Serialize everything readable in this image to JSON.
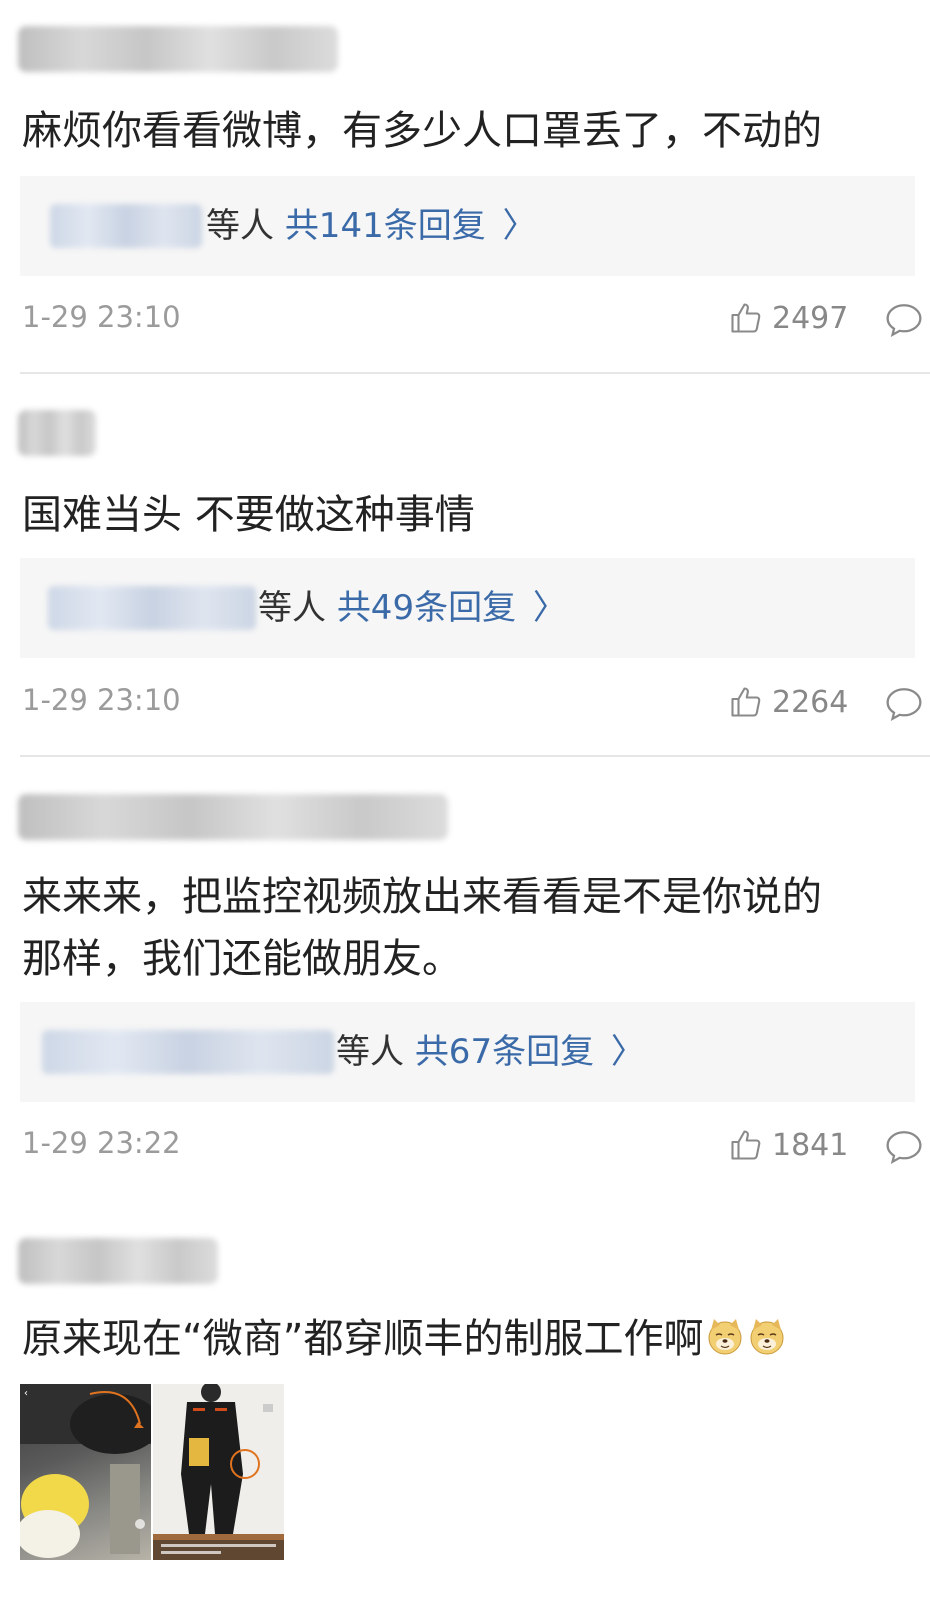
{
  "comments": [
    {
      "text": "麻烦你看看微博，有多少人口罩丢了，不动的",
      "reply_etc": "等人",
      "reply_count": "共141条回复",
      "time": "1-29 23:10",
      "likes": "2497"
    },
    {
      "text": "国难当头 不要做这种事情",
      "reply_etc": "等人",
      "reply_count": "共49条回复",
      "time": "1-29 23:10",
      "likes": "2264"
    },
    {
      "text_line1": "来来来，把监控视频放出来看看是不是你说的",
      "text_line2": "那样，我们还能做朋友。",
      "reply_etc": "等人",
      "reply_count": "共67条回复",
      "time": "1-29 23:22",
      "likes": "1841"
    },
    {
      "text": "原来现在“微商”都穿顺丰的制服工作啊",
      "emoji": "doge-emoji"
    }
  ],
  "icons": {
    "like": "thumbs-up-icon",
    "comment": "comment-bubble-icon",
    "chevron": "chevron-right-icon"
  },
  "colors": {
    "link_blue": "#3b6aa8",
    "meta_gray": "#9b9b9b",
    "reply_bg": "#f6f6f6"
  }
}
